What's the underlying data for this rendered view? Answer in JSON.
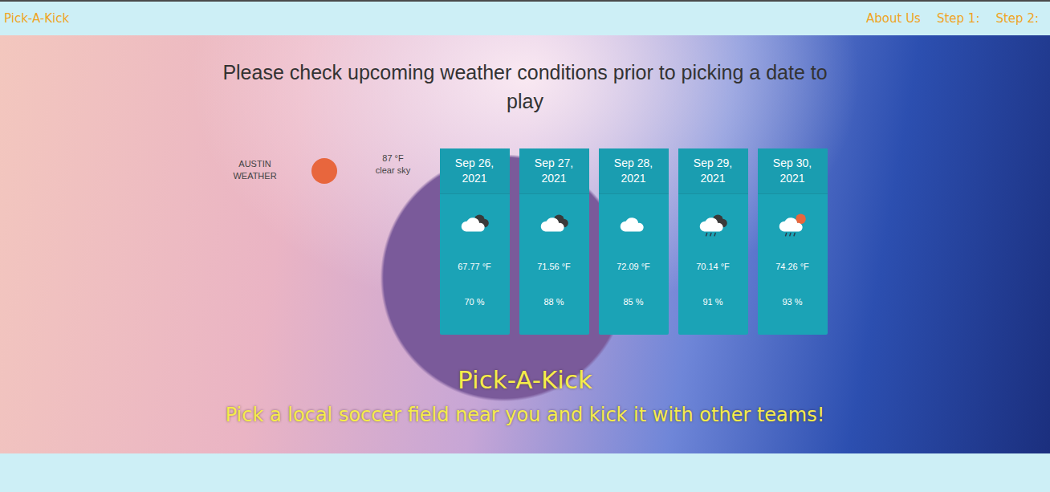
{
  "nav": {
    "brand": "Pick-A-Kick",
    "links": [
      "About Us",
      "Step 1:",
      "Step 2:"
    ]
  },
  "heading": "Please check upcoming weather conditions prior to picking a date to play",
  "current": {
    "city": "AUSTIN WEATHER",
    "temp": "87 °F",
    "description": "clear sky"
  },
  "forecast": [
    {
      "date": "Sep 26, 2021",
      "kind": "broken-clouds",
      "temp": "67.77 °F",
      "humidity": "70 %"
    },
    {
      "date": "Sep 27, 2021",
      "kind": "broken-clouds",
      "temp": "71.56 °F",
      "humidity": "88 %"
    },
    {
      "date": "Sep 28, 2021",
      "kind": "clouds",
      "temp": "72.09 °F",
      "humidity": "85 %"
    },
    {
      "date": "Sep 29, 2021",
      "kind": "rain",
      "temp": "70.14 °F",
      "humidity": "91 %"
    },
    {
      "date": "Sep 30, 2021",
      "kind": "sun-rain",
      "temp": "74.26 °F",
      "humidity": "93 %"
    }
  ],
  "hero": {
    "title": "Pick-A-Kick",
    "subtitle": "Pick a local soccer field near you and kick it with other teams!"
  }
}
